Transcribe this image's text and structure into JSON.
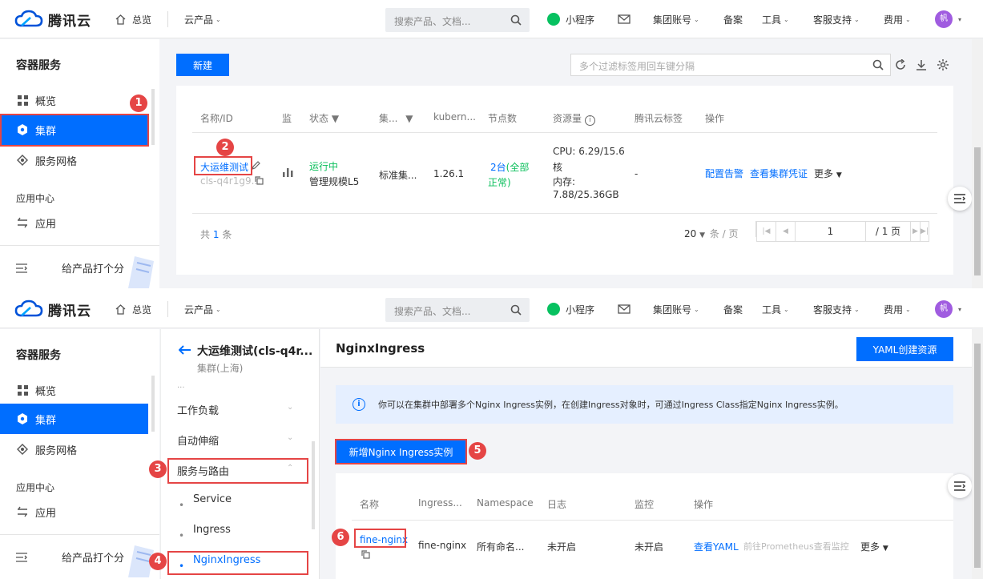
{
  "header": {
    "brand": "腾讯云",
    "overview": "总览",
    "products": "云产品",
    "search_placeholder": "搜索产品、文档...",
    "miniprogram": "小程序",
    "group_account": "集团账号",
    "beian": "备案",
    "tools": "工具",
    "support": "客服支持",
    "billing": "费用",
    "avatar": "帆"
  },
  "sidebar": {
    "title": "容器服务",
    "overview": "概览",
    "cluster": "集群",
    "service_mesh": "服务网格",
    "app_center": "应用中心",
    "app": "应用",
    "feedback": "给产品打个分"
  },
  "top": {
    "new_button": "新建",
    "filter_placeholder": "多个过滤标签用回车键分隔",
    "columns": [
      "名称/ID",
      "监",
      "状态",
      "集...",
      "kubern...",
      "节点数",
      "资源量",
      "腾讯云标签",
      "操作"
    ],
    "row": {
      "name": "大运维测试",
      "id": "cls-q4r1g9...",
      "status": "运行中",
      "scale": "管理规模L5",
      "cluster_type": "标准集...",
      "k8s_version": "1.26.1",
      "nodes": "2台",
      "nodes_status_open": "(全部",
      "nodes_status_close": "正常)",
      "cpu_line1": "CPU: 6.29/15.6",
      "cpu_line2": "核",
      "mem_line1": "内存:",
      "mem_line2": "7.88/25.36GB",
      "tags": "-",
      "op_alarm": "配置告警",
      "op_cred": "查看集群凭证",
      "op_more": "更多"
    },
    "total_prefix": "共",
    "total_count": "1",
    "total_suffix": "条",
    "page_size": "20",
    "page_size_unit": "条 / 页",
    "page_input": "1",
    "page_total": "/ 1 页"
  },
  "bottom": {
    "cluster_title": "大运维测试(cls-q4r...",
    "cluster_region": "集群(上海)",
    "menu_cut": "...",
    "menu_workload": "工作负载",
    "menu_autoscale": "自动伸缩",
    "menu_service_route": "服务与路由",
    "sub_service": "Service",
    "sub_ingress": "Ingress",
    "sub_nginx_ingress": "NginxIngress",
    "page_title": "NginxIngress",
    "yaml_button": "YAML创建资源",
    "info_text": "你可以在集群中部署多个Nginx Ingress实例，在创建Ingress对象时，可通过Ingress Class指定Nginx Ingress实例。",
    "new_nginx_button": "新增Nginx Ingress实例",
    "columns": [
      "名称",
      "Ingress...",
      "Namespace",
      "日志",
      "监控",
      "操作"
    ],
    "row": {
      "name": "fine-nginx",
      "ingress_class": "fine-nginx",
      "namespace": "所有命名...",
      "log": "未开启",
      "monitor": "未开启",
      "op_yaml": "查看YAML",
      "op_prom": "前往Prometheus查看监控",
      "op_more": "更多"
    }
  },
  "badges": [
    "1",
    "2",
    "3",
    "4",
    "5",
    "6"
  ]
}
